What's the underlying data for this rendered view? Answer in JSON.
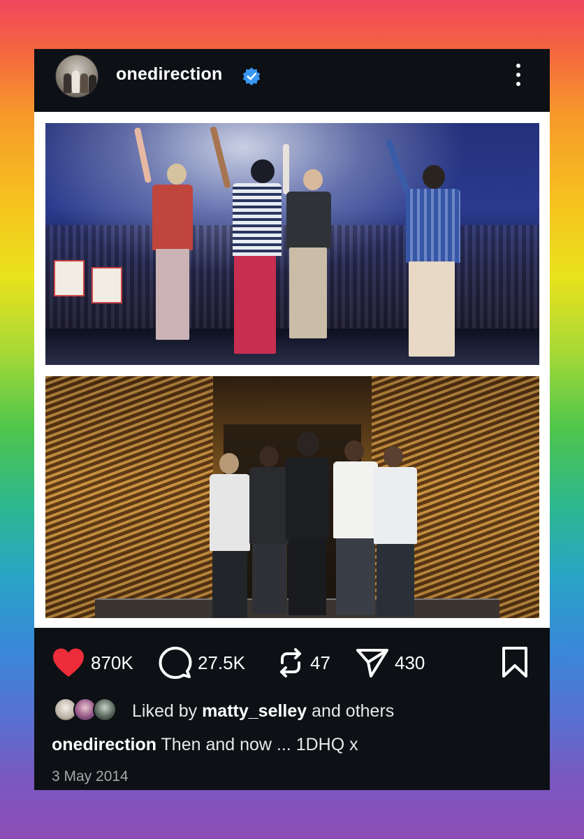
{
  "post": {
    "username": "onedirection",
    "verified": true,
    "verified_color": "#3897f0",
    "avatar_icon": "group-photo-avatar",
    "menu_icon": "more-vertical-icon",
    "images": [
      {
        "description_icon": "concert-photo-then"
      },
      {
        "description_icon": "concert-photo-now"
      }
    ],
    "actions": {
      "likes": "870K",
      "comments": "27.5K",
      "reposts": "47",
      "shares": "430",
      "like_color": "#ed2c3a"
    },
    "liked_by": {
      "prefix": "Liked by",
      "user": "matty_selley",
      "suffix": "and others"
    },
    "caption": {
      "user": "onedirection",
      "text": "Then and now ... 1DHQ x"
    },
    "date": "3 May 2014"
  }
}
